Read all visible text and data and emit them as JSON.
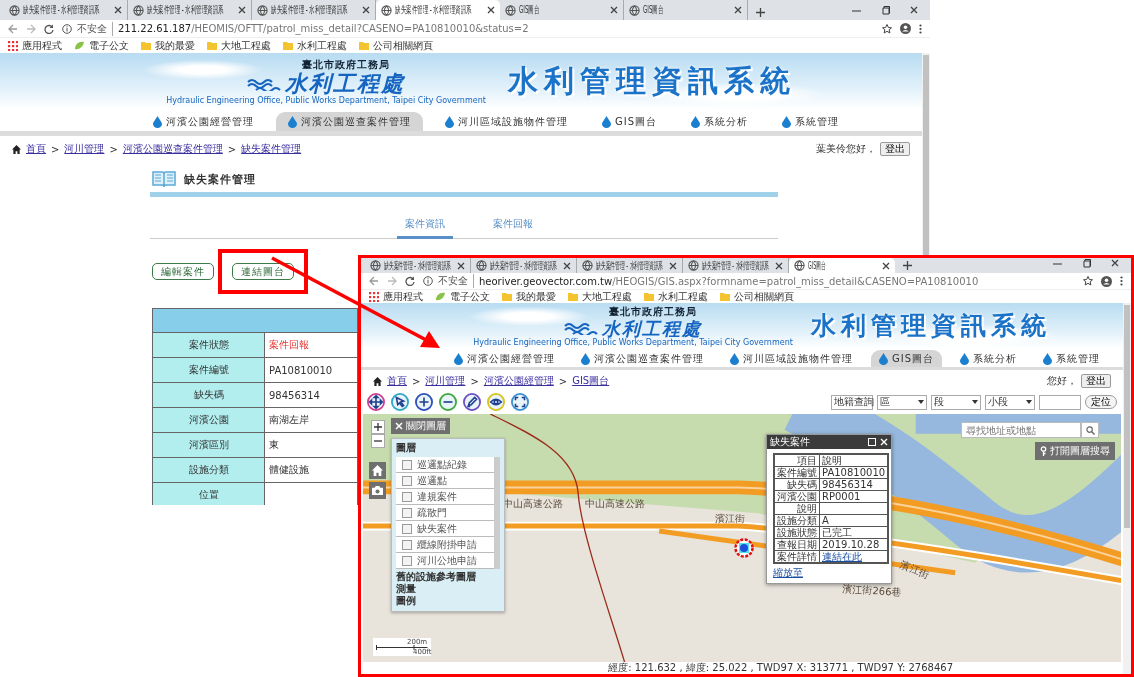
{
  "case_window": {
    "browser": {
      "tabs": [
        {
          "title": "缺失案件管理 - 水利管理資訊系",
          "selected": false
        },
        {
          "title": "缺失案件管理 - 水利管理資訊系",
          "selected": false
        },
        {
          "title": "缺失案件管理 - 水利管理資訊系",
          "selected": false
        },
        {
          "title": "缺失案件管理 - 水利管理資訊系",
          "selected": true
        },
        {
          "title": "GIS圖台",
          "selected": false
        },
        {
          "title": "GIS圖台",
          "selected": false
        }
      ],
      "security": "不安全",
      "url_host": "211.22.61.187",
      "url_path": "/HEOMIS/OFTT/patrol_miss_detail?CASENO=PA10810010&status=2",
      "bookmarks": [
        {
          "label": "應用程式",
          "kind": "apps"
        },
        {
          "label": "電子公文",
          "kind": "leaf"
        },
        {
          "label": "我的最愛",
          "kind": "folder"
        },
        {
          "label": "大地工程處",
          "kind": "folder"
        },
        {
          "label": "水利工程處",
          "kind": "folder"
        },
        {
          "label": "公司相關網頁",
          "kind": "folder"
        }
      ]
    },
    "site": {
      "agency": "臺北市政府工務局",
      "office": "水利工程處",
      "office_en": "Hydraulic Engineering Office, Public Works Department, Taipei City Government",
      "title": "水利管理資訊系統",
      "nav": [
        {
          "label": "河濱公園經營管理",
          "selected": false
        },
        {
          "label": "河濱公園巡查案件管理",
          "selected": true
        },
        {
          "label": "河川區域設施物件管理",
          "selected": false
        },
        {
          "label": "GIS圖台",
          "selected": false
        },
        {
          "label": "系統分析",
          "selected": false
        },
        {
          "label": "系統管理",
          "selected": false
        }
      ]
    },
    "page": {
      "breadcrumb": {
        "separator": ">",
        "items": [
          {
            "label": "首頁",
            "kind": "home"
          },
          {
            "label": "河川管理",
            "kind": "link"
          },
          {
            "label": "河濱公園巡查案件管理",
            "kind": "link"
          },
          {
            "label": "缺失案件管理",
            "kind": "link"
          }
        ]
      },
      "user": {
        "greeting": "葉美伶您好，",
        "logout": "登出"
      },
      "title": "缺失案件管理",
      "tabs": [
        {
          "label": "案件資訊",
          "selected": true
        },
        {
          "label": "案件回報",
          "selected": false
        }
      ],
      "actions": [
        {
          "label": "編輯案件",
          "highlighted": false
        },
        {
          "label": "連結圖台",
          "highlighted": true
        }
      ],
      "table": [
        {
          "label": "案件狀態",
          "value": "案件回報",
          "kind": "status"
        },
        {
          "label": "案件編號",
          "value": "PA10810010",
          "kind": "text"
        },
        {
          "label": "缺失碼",
          "value": "98456314",
          "kind": "text"
        },
        {
          "label": "河濱公園",
          "value": "南湖左岸",
          "kind": "text"
        },
        {
          "label": "河濱區別",
          "value": "東",
          "kind": "text"
        },
        {
          "label": "設施分類",
          "value": "體健設施",
          "kind": "text"
        },
        {
          "label": "位置",
          "kind": "text"
        }
      ]
    }
  },
  "gis_window": {
    "browser": {
      "tabs": [
        {
          "title": "缺失案件管理 - 水利管理資訊系",
          "selected": false
        },
        {
          "title": "缺失案件管理 - 水利管理資訊系",
          "selected": false
        },
        {
          "title": "缺失案件管理 - 水利管理資訊系",
          "selected": false
        },
        {
          "title": "缺失案件管理 - 水利管理資訊系",
          "selected": false
        },
        {
          "title": "GIS圖台",
          "selected": true
        }
      ],
      "security": "不安全",
      "url_host": "heoriver.geovector.com.tw",
      "url_path": "/HEOGIS/GIS.aspx?formname=patrol_miss_detail&CASENO=PA10810010",
      "bookmarks": [
        {
          "label": "應用程式",
          "kind": "apps"
        },
        {
          "label": "電子公文",
          "kind": "leaf"
        },
        {
          "label": "我的最愛",
          "kind": "folder"
        },
        {
          "label": "大地工程處",
          "kind": "folder"
        },
        {
          "label": "水利工程處",
          "kind": "folder"
        },
        {
          "label": "公司相關網頁",
          "kind": "folder"
        }
      ]
    },
    "site": {
      "agency": "臺北市政府工務局",
      "office": "水利工程處",
      "office_en": "Hydraulic Engineering Office, Public Works Department, Taipei City Government",
      "title": "水利管理資訊系統",
      "nav": [
        {
          "label": "河濱公園經營管理",
          "selected": false
        },
        {
          "label": "河濱公園巡查案件管理",
          "selected": false
        },
        {
          "label": "河川區域設施物件管理",
          "selected": false
        },
        {
          "label": "GIS圖台",
          "selected": true
        },
        {
          "label": "系統分析",
          "selected": false
        },
        {
          "label": "系統管理",
          "selected": false
        }
      ]
    },
    "page": {
      "breadcrumb": {
        "separator": ">",
        "items": [
          {
            "label": "首頁",
            "kind": "home"
          },
          {
            "label": "河川管理",
            "kind": "link"
          },
          {
            "label": "河濱公園經管理",
            "kind": "link"
          },
          {
            "label": "GIS圖台",
            "kind": "link"
          }
        ]
      },
      "user": {
        "greeting": "您好，",
        "logout": "登出"
      },
      "land_search": {
        "selects": [
          "地籍查詢",
          "區",
          "段",
          "小段"
        ],
        "button": "定位"
      },
      "map": {
        "layer_toggle": "關閉圖層",
        "layers": {
          "title": "圖層",
          "items": [
            {
              "label": "巡邏點紀錄",
              "checked": false
            },
            {
              "label": "巡邏點",
              "checked": false
            },
            {
              "label": "違規案件",
              "checked": false
            },
            {
              "label": "疏散門",
              "checked": false
            },
            {
              "label": "缺失案件",
              "checked": false
            },
            {
              "label": "纜線附掛申請",
              "checked": false
            },
            {
              "label": "河川公地申請",
              "checked": false
            }
          ],
          "groups": [
            "舊的設施參考圖層",
            "測量",
            "圖例"
          ]
        },
        "popup": {
          "title": "缺失案件",
          "rows": [
            {
              "label": "項目",
              "value": "說明",
              "kind": "text"
            },
            {
              "label": "案件編號",
              "value": "PA10810010",
              "kind": "text"
            },
            {
              "label": "缺失碼",
              "value": "98456314",
              "kind": "text"
            },
            {
              "label": "河濱公園",
              "value": "RP0001",
              "kind": "text"
            },
            {
              "label": "說明",
              "kind": "text"
            },
            {
              "label": "設施分類",
              "value": "A",
              "kind": "text"
            },
            {
              "label": "設施狀態",
              "value": "已完工",
              "kind": "text"
            },
            {
              "label": "查報日期",
              "value": "2019.10.28",
              "kind": "text"
            },
            {
              "label": "案件詳情",
              "value": "連結在此",
              "kind": "link"
            }
          ],
          "zoom_link": "縮放至"
        },
        "search": {
          "placeholder": "尋找地址或地點"
        },
        "layer_search": "打開圖層搜尋",
        "road_labels": [
          "中山高速公路",
          "中山高速公路",
          "濱江街",
          "濱江街",
          "濱江街266巷"
        ],
        "scale": {
          "metric": "200m",
          "imperial": "400ft"
        },
        "coordinates": "經度: 121.632 , 緯度: 25.022 , TWD97 X: 313771 , TWD97 Y: 2768467"
      }
    }
  }
}
